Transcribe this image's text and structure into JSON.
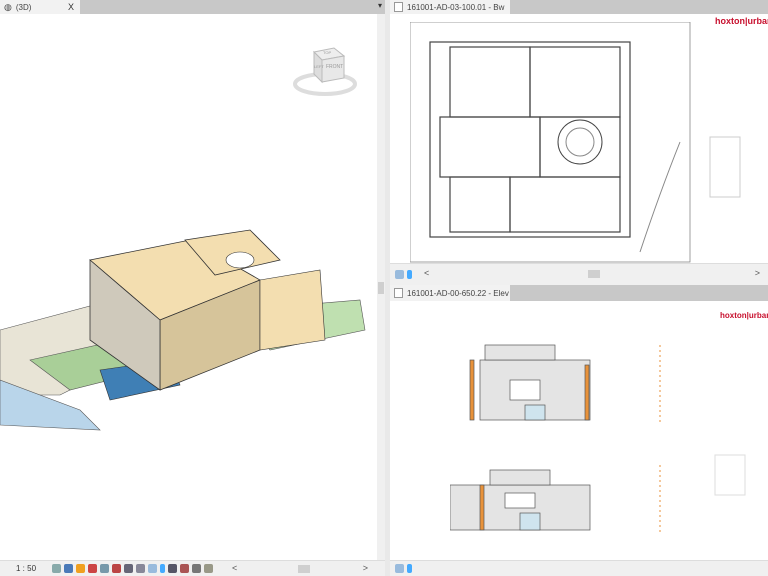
{
  "views": {
    "view3d": {
      "title": "(3D)",
      "close": "X",
      "scale": "1 : 50",
      "viewcube": {
        "top": "TOP",
        "left": "LEFT",
        "front": "FRONT"
      }
    },
    "plan": {
      "title": "161001-AD-03-100.01 - Bw",
      "logo": "hoxton|urban"
    },
    "elevation": {
      "title": "161001-AD-00-650.22 - Elev",
      "logo": "hoxton|urban"
    }
  },
  "scroll": {
    "left": "<",
    "right": ">"
  },
  "colors": {
    "tabbar": "#c8c8c8",
    "logo": "#c8102e",
    "floor": "#f3deb0",
    "pool": "#3f7fb5"
  }
}
